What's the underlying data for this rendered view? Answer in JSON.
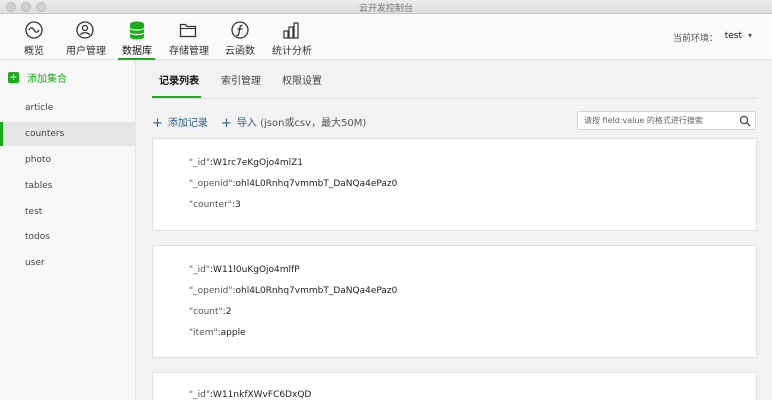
{
  "window": {
    "title": "云开发控制台"
  },
  "toolbar": {
    "items": [
      {
        "label": "概览",
        "icon": "overview-icon"
      },
      {
        "label": "用户管理",
        "icon": "user-icon"
      },
      {
        "label": "数据库",
        "icon": "database-icon"
      },
      {
        "label": "存储管理",
        "icon": "folder-icon"
      },
      {
        "label": "云函数",
        "icon": "cloud-function-icon"
      },
      {
        "label": "统计分析",
        "icon": "bar-chart-icon"
      }
    ],
    "active_index": 2,
    "env_label": "当前环境：",
    "env_value": "test"
  },
  "sidebar": {
    "add_label": "添加集合",
    "collections": [
      "article",
      "counters",
      "photo",
      "tables",
      "test",
      "todos",
      "user"
    ],
    "active_collection": "counters"
  },
  "tabs": [
    "记录列表",
    "索引管理",
    "权限设置"
  ],
  "actions": {
    "add_record": "添加记录",
    "import": "导入",
    "import_hint": "(json或csv，最大50M)"
  },
  "search": {
    "placeholder": "请按 field:value 的格式进行搜索"
  },
  "records": [
    {
      "fields": [
        {
          "key": "\"_id\"",
          "value": "W1rc7eKgOjo4mlZ1"
        },
        {
          "key": "\"_openid\"",
          "value": "ohl4L0Rnhq7vmmbT_DaNQa4ePaz0"
        },
        {
          "key": "\"counter\"",
          "value": "3"
        }
      ]
    },
    {
      "fields": [
        {
          "key": "\"_id\"",
          "value": "W11l0uKgOjo4mlfP"
        },
        {
          "key": "\"_openid\"",
          "value": "ohl4L0Rnhq7vmmbT_DaNQa4ePaz0"
        },
        {
          "key": "\"count\"",
          "value": "2"
        },
        {
          "key": "\"item\"",
          "value": "apple"
        }
      ]
    },
    {
      "fields": [
        {
          "key": "\"_id\"",
          "value": "W11nkfXWvFC6DxQD"
        }
      ]
    }
  ],
  "colors": {
    "accent": "#1aad19",
    "link": "#2d5c8f"
  }
}
